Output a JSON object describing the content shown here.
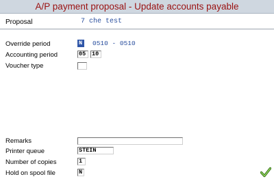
{
  "window": {
    "title": "A/P payment proposal - Update accounts payable"
  },
  "proposal": {
    "label": "Proposal",
    "value": "7 che test"
  },
  "form": {
    "override_period": {
      "label": "Override period",
      "value": "N",
      "range": "0510 - 0510"
    },
    "accounting_period": {
      "label": "Accounting period",
      "period": "05",
      "year": "10"
    },
    "voucher_type": {
      "label": "Voucher type",
      "value": ""
    },
    "remarks": {
      "label": "Remarks",
      "value": ""
    },
    "printer_queue": {
      "label": "Printer queue",
      "value": "STEIN"
    },
    "number_of_copies": {
      "label": "Number of copies",
      "value": "1"
    },
    "hold_on_spool_file": {
      "label": "Hold on spool file",
      "value": "N"
    }
  },
  "actions": {
    "ok_icon": "checkmark-icon",
    "accent_color": "#4a8a2a"
  },
  "colors": {
    "title_text": "#9a1111",
    "value_text": "#2a4f9e",
    "titlebar_bg": "#cfd7e0"
  }
}
